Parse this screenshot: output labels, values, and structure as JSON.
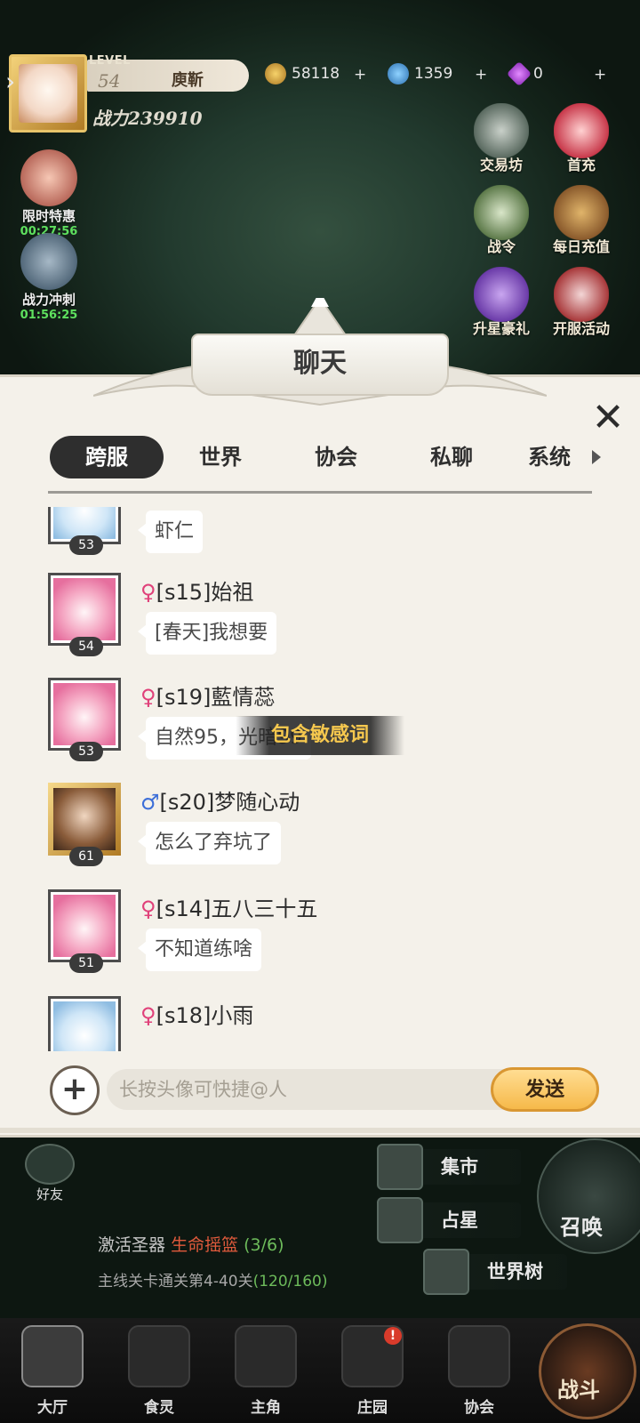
{
  "hud": {
    "level_tag": "LEVEL",
    "level": "54",
    "player_name": "庾靳",
    "power": "战力239910",
    "gold": "58118",
    "crystals": "1359",
    "gems": "0"
  },
  "left_events": [
    {
      "label": "限时特惠",
      "timer": "00:27:56"
    },
    {
      "label": "战力冲刺",
      "timer": "01:56:25"
    }
  ],
  "right_events": [
    {
      "label": "交易坊"
    },
    {
      "label": "首充"
    },
    {
      "label": "战令"
    },
    {
      "label": "每日充值"
    },
    {
      "label": "升星豪礼"
    },
    {
      "label": "开服活动"
    }
  ],
  "chat": {
    "title": "聊天",
    "tabs": [
      "跨服",
      "世界",
      "协会",
      "私聊",
      "系统"
    ],
    "active_tab": "跨服",
    "messages": [
      {
        "level": "53",
        "gender": "",
        "name": "",
        "text": "虾仁"
      },
      {
        "level": "54",
        "gender": "♀",
        "name": "[s15]始祖",
        "text": "[春天]我想要"
      },
      {
        "level": "53",
        "gender": "♀",
        "name": "[s19]藍情蕊",
        "text": "自然95，光暗99"
      },
      {
        "level": "61",
        "gender": "♂",
        "name": "[s20]梦随心动",
        "text": "怎么了弃坑了"
      },
      {
        "level": "51",
        "gender": "♀",
        "name": "[s14]五八三十五",
        "text": "不知道练啥"
      },
      {
        "level": "",
        "gender": "♀",
        "name": "[s18]小雨",
        "text": ""
      }
    ],
    "sensitive_notice": "包含敏感词",
    "input_placeholder": "长按头像可快捷@人",
    "send_label": "发送"
  },
  "lobby": {
    "friends_label": "好友",
    "quest_prefix": "激活圣器",
    "quest_highlight": "生命摇篮",
    "quest_progress": "(3/6)",
    "quest2_text": "主线关卡通关第4-40关",
    "quest2_progress": "(120/160)",
    "features": [
      "集市",
      "占星",
      "世界树"
    ],
    "summon_label": "召唤"
  },
  "nav": {
    "items": [
      "大厅",
      "食灵",
      "主角",
      "庄园",
      "协会"
    ],
    "active": "大厅",
    "manor_badge": "!",
    "battle_label": "战斗"
  },
  "colors": {
    "panel_bg": "#f4f1ea",
    "active_tab_bg": "#2e2e2e",
    "female_symbol": "#e0417a",
    "male_symbol": "#3d6fd8",
    "sensitive_text": "#f6c84e",
    "send_button": "#f6b94a",
    "timer_green": "#5ee05e"
  }
}
